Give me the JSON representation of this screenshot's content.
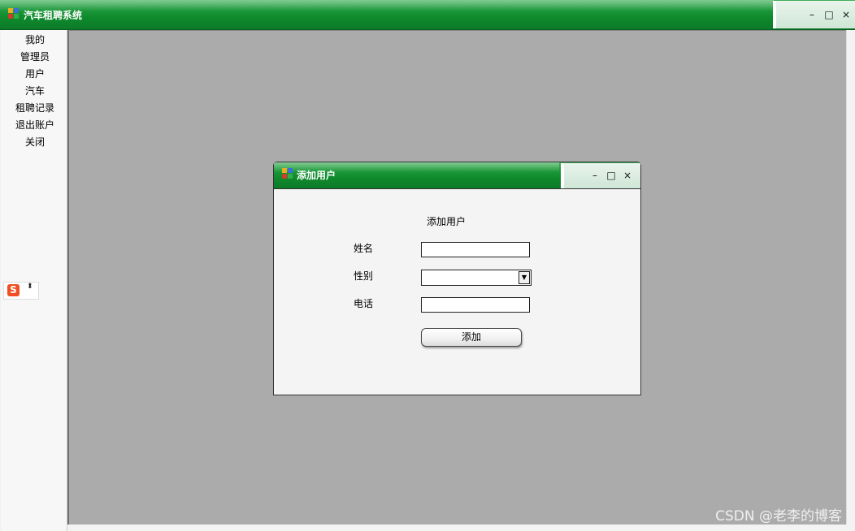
{
  "app": {
    "title": "汽车租聘系统",
    "window_controls": {
      "minimize": "–",
      "maximize": "□",
      "close": "×"
    }
  },
  "sidebar": {
    "items": [
      {
        "label": "我的"
      },
      {
        "label": "管理员"
      },
      {
        "label": "用户"
      },
      {
        "label": "汽车"
      },
      {
        "label": "租聘记录"
      },
      {
        "label": "退出账户"
      },
      {
        "label": "关闭"
      }
    ]
  },
  "ime": {
    "icon": "sogou-s-icon",
    "logo_text": "S",
    "arrows": "⬍"
  },
  "dialog": {
    "title": "添加用户",
    "window_controls": {
      "minimize": "–",
      "maximize": "□",
      "close": "×"
    },
    "heading": "添加用户",
    "fields": {
      "name": {
        "label": "姓名",
        "value": ""
      },
      "gender": {
        "label": "性别",
        "value": "",
        "arrow": "▼"
      },
      "phone": {
        "label": "电话",
        "value": ""
      }
    },
    "submit_label": "添加"
  },
  "watermark": "CSDN @老李的博客",
  "colors": {
    "titlebar": "#0f8a2d",
    "mdi_background": "#ababab",
    "dialog_background": "#f4f4f4"
  }
}
